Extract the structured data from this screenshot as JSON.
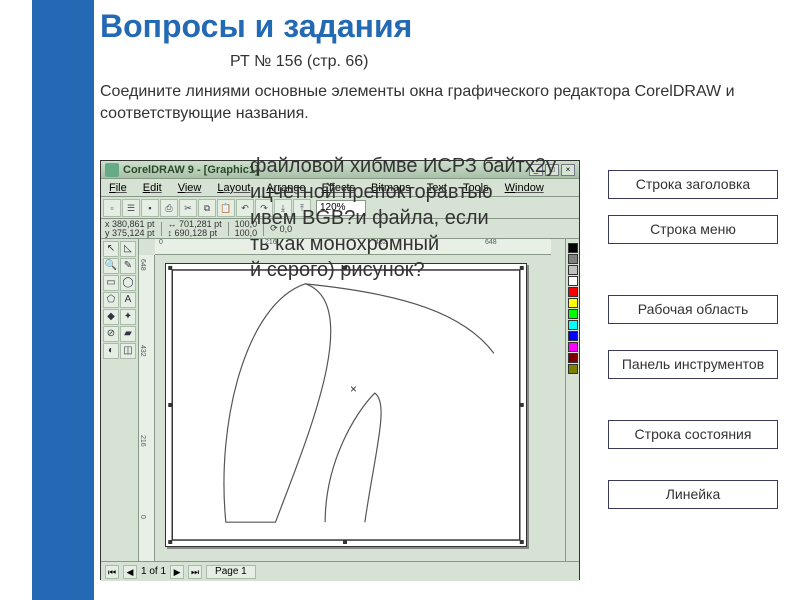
{
  "header": {
    "title": "Вопросы и задания",
    "subtitle": "РТ № 156 (стр. 66)",
    "instruction": "Соедините линиями основные элементы окна графического редактора CorelDRAW и соответствующие названия."
  },
  "overlay": {
    "line1": "файловой хибмве ИСРЗ байтх2у",
    "line2": "ицчетной препокторавтью",
    "line3": "ивем BGB?и файла, если",
    "line4": "ть как монохромный",
    "line5": "й серого) рисунок?"
  },
  "app": {
    "title": "CorelDRAW 9 - [Graphic1]",
    "menu": [
      "File",
      "Edit",
      "View",
      "Layout",
      "Arrange",
      "Effects",
      "Bitmaps",
      "Text",
      "Tools",
      "Window"
    ],
    "zoom": "120%",
    "coords": {
      "x": "x 380,861 pt",
      "y": "y 375,124 pt",
      "w": "↔ 701,281 pt",
      "h": "↕ 690,128 pt",
      "pw": "100,0",
      "ph": "100,0",
      "angle": "0,0"
    },
    "page_tab": "Page 1",
    "page_info": "1 of 1",
    "ruler_h": [
      "0",
      "216",
      "432",
      "648"
    ],
    "ruler_v": [
      "648",
      "432",
      "216",
      "0"
    ],
    "swatches": [
      "#000000",
      "#808080",
      "#c0c0c0",
      "#ffffff",
      "#ff0000",
      "#ffff00",
      "#00ff00",
      "#00ffff",
      "#0000ff",
      "#ff00ff",
      "#800000",
      "#808000"
    ]
  },
  "labels": {
    "l1": "Строка заголовка",
    "l2": "Строка меню",
    "l3": "Рабочая область",
    "l4": "Панель инструментов",
    "l5": "Строка состояния",
    "l6": "Линейка"
  }
}
